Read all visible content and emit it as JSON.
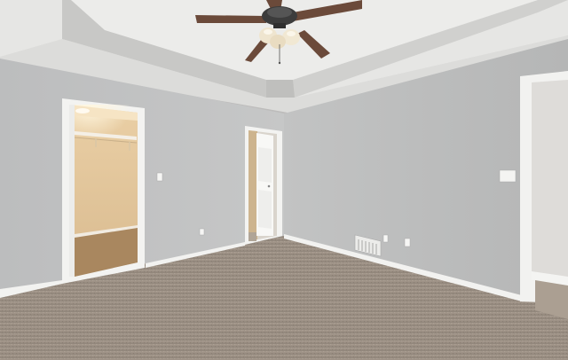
{
  "scene": {
    "kind": "photograph",
    "subject": "empty-bedroom-interior",
    "colors": {
      "wall_left": "#c3c4c4",
      "wall_right": "#bcbdbd",
      "ceiling": "#e8e8e6",
      "tray_band": "#c9c9c7",
      "carpet": "#a09488",
      "trim": "#f4f4f2",
      "closet_wall": "#e3c79e",
      "closet_floor": "#ab8a62",
      "fan_blade": "#6b4a3a",
      "fan_body": "#3a3a3a",
      "light_glass": "#efe5cf"
    },
    "elements": [
      "ceiling-fan-with-light",
      "tray-ceiling",
      "walk-in-closet-doorway",
      "bathroom-doorway",
      "right-doorway",
      "light-switch",
      "floor-vent",
      "wall-outlet",
      "baseboard-trim",
      "carpet-floor"
    ]
  }
}
